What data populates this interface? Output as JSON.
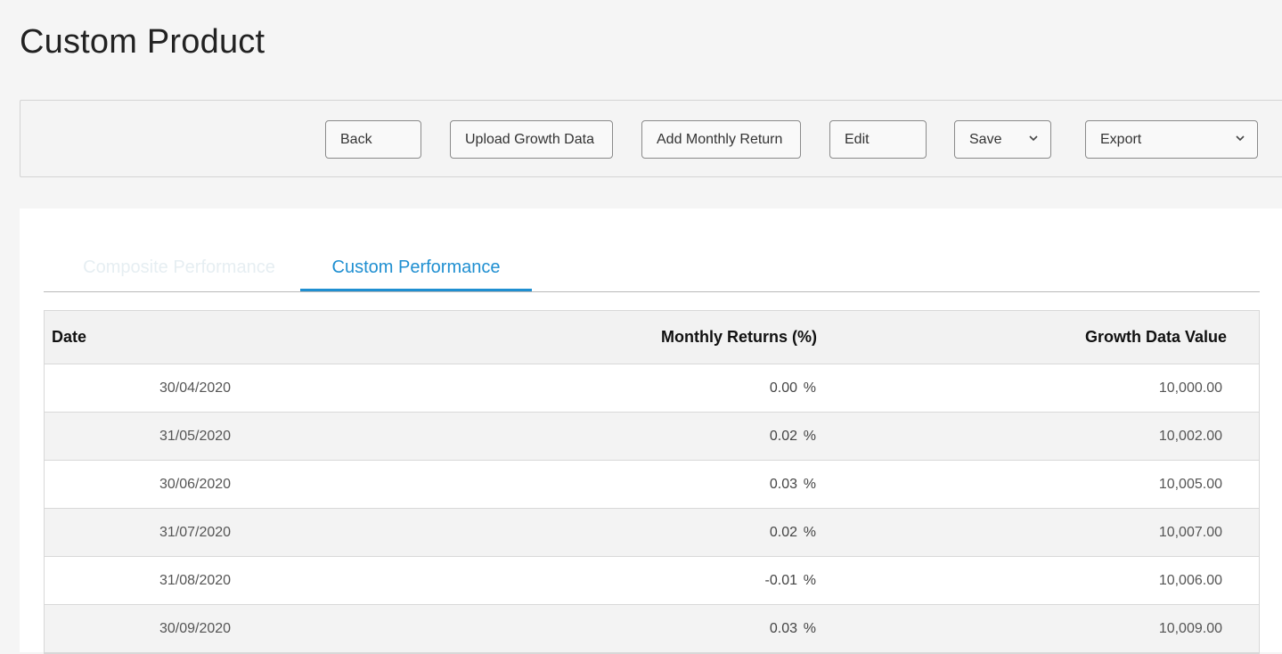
{
  "page": {
    "title": "Custom Product"
  },
  "toolbar": {
    "back_label": "Back",
    "upload_label": "Upload Growth Data",
    "add_label": "Add Monthly Return",
    "edit_label": "Edit",
    "save_label": "Save",
    "export_label": "Export"
  },
  "tabs": [
    {
      "label": "Composite Performance",
      "active": false
    },
    {
      "label": "Custom Performance",
      "active": true
    }
  ],
  "table": {
    "headers": [
      "Date",
      "Monthly Returns (%)",
      "Growth Data Value"
    ],
    "pct_symbol": "%",
    "rows": [
      {
        "date": "30/04/2020",
        "ret": "0.00",
        "growth": "10,000.00"
      },
      {
        "date": "31/05/2020",
        "ret": "0.02",
        "growth": "10,002.00"
      },
      {
        "date": "30/06/2020",
        "ret": "0.03",
        "growth": "10,005.00"
      },
      {
        "date": "31/07/2020",
        "ret": "0.02",
        "growth": "10,007.00"
      },
      {
        "date": "31/08/2020",
        "ret": "-0.01",
        "growth": "10,006.00"
      },
      {
        "date": "30/09/2020",
        "ret": "0.03",
        "growth": "10,009.00"
      }
    ]
  },
  "colors": {
    "accent": "#1f8fd1",
    "header_bg": "#f2f2f2",
    "row_alt_bg": "#f3f3f3"
  },
  "icons": {
    "dropdown": "chevron-down-icon"
  }
}
